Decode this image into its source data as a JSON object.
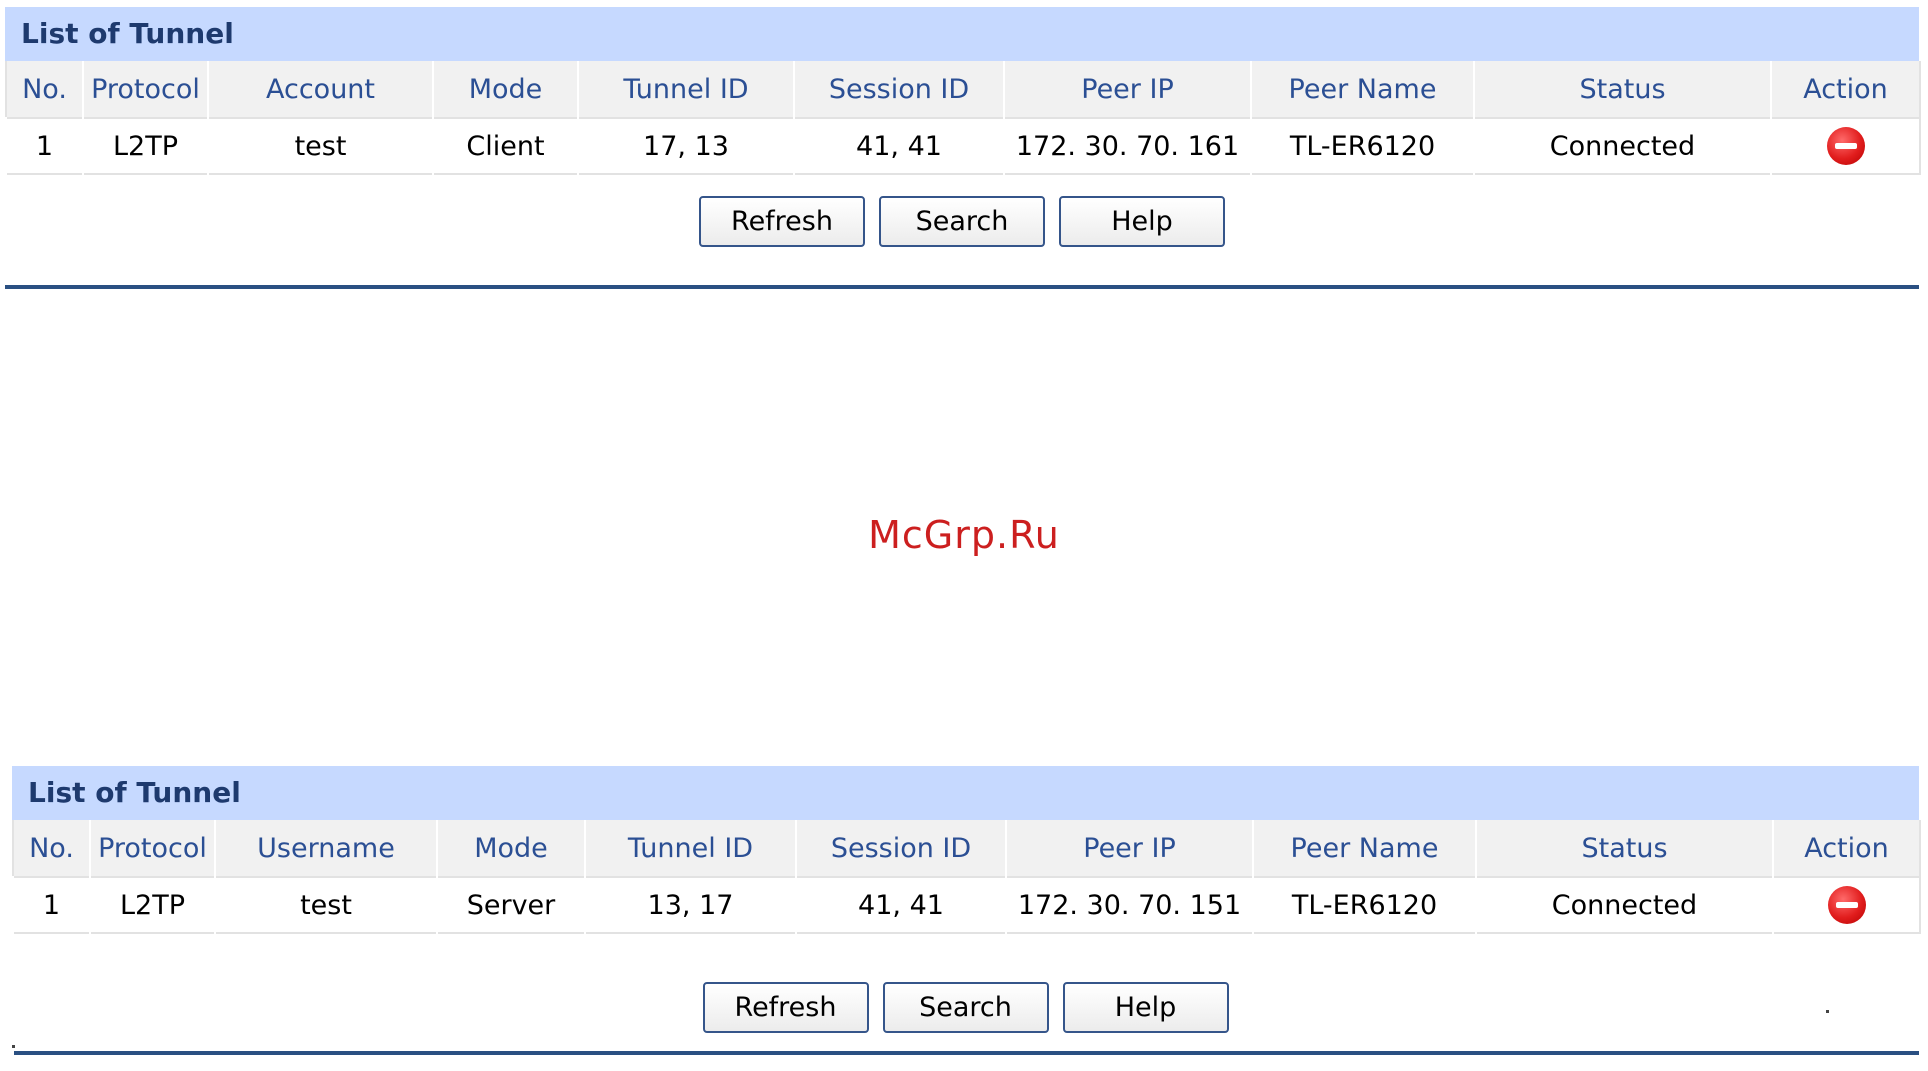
{
  "panels": [
    {
      "title": "List of Tunnel",
      "columns": [
        "No.",
        "Protocol",
        "Account",
        "Mode",
        "Tunnel ID",
        "Session ID",
        "Peer IP",
        "Peer Name",
        "Status",
        "Action"
      ],
      "rows": [
        {
          "no": "1",
          "protocol": "L2TP",
          "account": "test",
          "mode": "Client",
          "tunnel_id": "17, 13",
          "session_id": "41, 41",
          "peer_ip": "172. 30. 70. 161",
          "peer_name": "TL-ER6120",
          "status": "Connected",
          "action_icon": "delete-icon"
        }
      ],
      "buttons": {
        "refresh": "Refresh",
        "search": "Search",
        "help": "Help"
      }
    },
    {
      "title": "List of Tunnel",
      "columns": [
        "No.",
        "Protocol",
        "Username",
        "Mode",
        "Tunnel ID",
        "Session ID",
        "Peer IP",
        "Peer Name",
        "Status",
        "Action"
      ],
      "rows": [
        {
          "no": "1",
          "protocol": "L2TP",
          "account": "test",
          "mode": "Server",
          "tunnel_id": "13, 17",
          "session_id": "41, 41",
          "peer_ip": "172. 30. 70. 151",
          "peer_name": "TL-ER6120",
          "status": "Connected",
          "action_icon": "delete-icon"
        }
      ],
      "buttons": {
        "refresh": "Refresh",
        "search": "Search",
        "help": "Help"
      }
    }
  ],
  "watermark": "McGrp.Ru",
  "colors": {
    "title_bg": "#c6d9ff",
    "title_text": "#1e3a6e",
    "header_text": "#2b4f94",
    "rule": "#2a5082",
    "delete_icon": "#e11d1d",
    "watermark": "#cc1f1f"
  }
}
